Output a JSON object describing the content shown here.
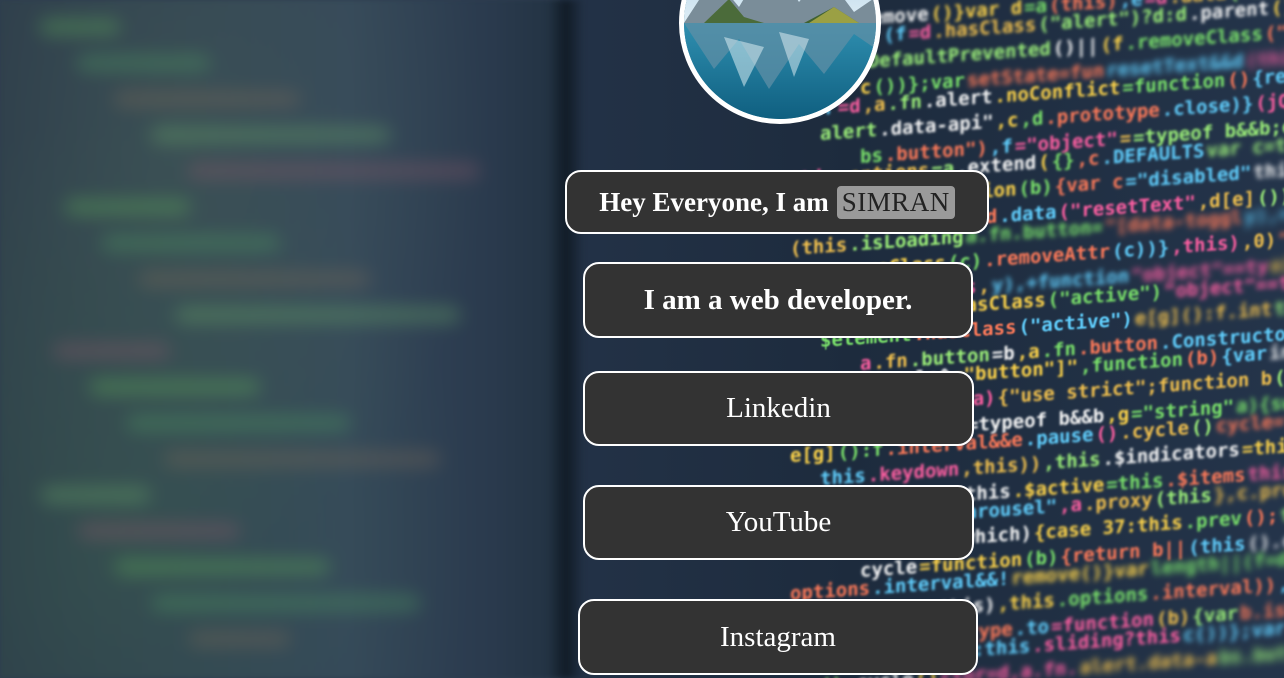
{
  "profile": {
    "greeting": "Hey Everyone, I am",
    "name": "SIMRAN",
    "tagline": "I am a web developer."
  },
  "links": [
    {
      "label": "Linkedin"
    },
    {
      "label": "YouTube"
    },
    {
      "label": "Instagram"
    }
  ],
  "background_code": [
    "remove()}var d=a(this),e=d.data(\"bs.alert\");",
    "length||(f=d.hasClass(\"alert\")?d:d.parent()),",
    "b.isDefaultPrevented()||(f.removeClass(\"in\")",
    "c())};var",
    "ctor=d,a.fn.alert.noConflict=function(){return",
    "alert.data-api\",c,d.prototype.close)}(jQuery),",
    "bs.button\"),f=\"object\"==typeof b&&b;e||d.data",
    "this.options=a.extend({},c.DEFAULTS",
    "setState=function(b){var c=\"disabled\"",
    "resetText&&d.data(\"resetText\",d[e]())",
    "(this.isLoading",
    "removeClass(c).removeAttr(c))},this),0)",
    "var c=this,",
    "this.$element.hasClass(\"active\")",
    "$element.hasClass(\"active\")",
    "a.fn.button=b,a.fn.button.Constructor=c,a.fn.button",
    "\"[data-toggle^=\"button\"]\",function(b){var",
    "y),+function(a){\"use strict\";function b(b){",
    "\"object\"==typeof b&&b,g=\"string\"",
    "e[g]():f.interval&&e.pause().cycle()",
    "this.keydown,this)),this.$indicators=this.$element",
    "interval=this.$active=this.$items",
    "mouseleave.bs.carousel\",a.proxy(this",
    "a){switch(a.which){case 37:this.prev();",
    "cycle=function(b){return b||(this",
    "options.interval&&!",
    "this.next,this),this.options.interval)),this",
    "},c.prototype.to=function(b){var",
    "th-1||0>b?void 0:this.sliding?this",
    "().cycle()"
  ],
  "colors": {
    "card_bg": "#333333",
    "card_border": "#ffffff",
    "name_chip_bg": "#9a9a9a",
    "text": "#ffffff"
  }
}
